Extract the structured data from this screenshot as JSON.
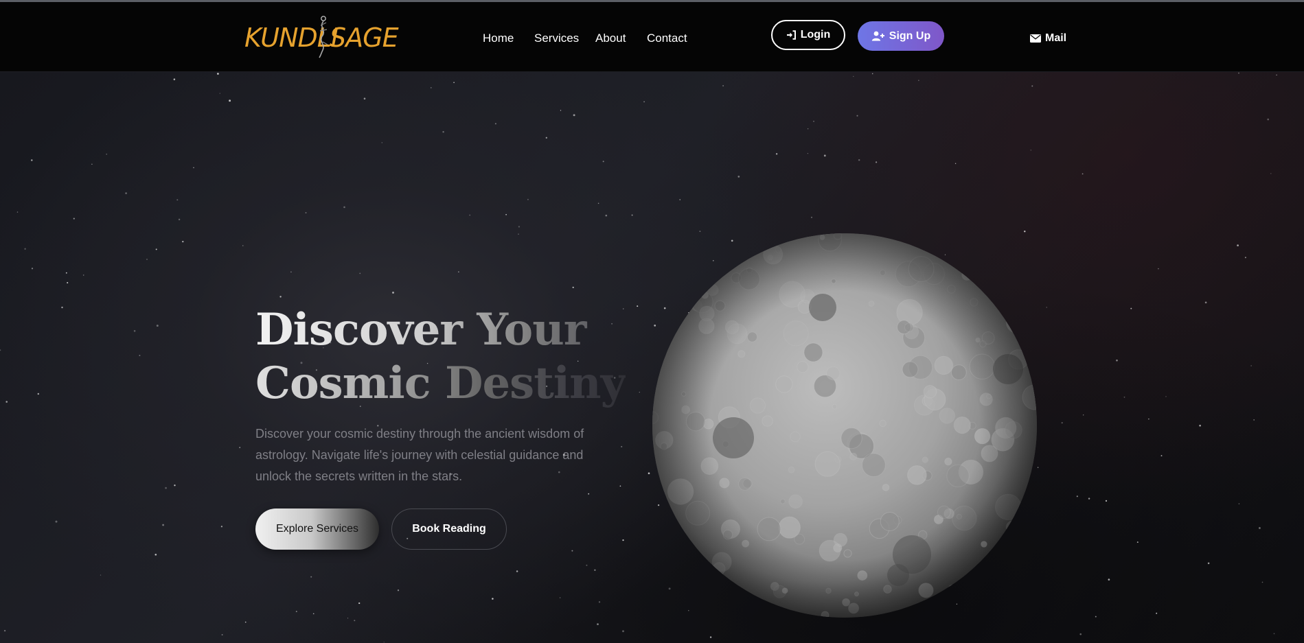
{
  "brand": {
    "logo_left": "KUNDLI",
    "logo_right": "SAGE",
    "color": "#e6a22e"
  },
  "nav": {
    "links": [
      {
        "label": "Home"
      },
      {
        "label": "Services"
      },
      {
        "label": "About"
      },
      {
        "label": "Contact"
      }
    ],
    "login_label": "Login",
    "signup_label": "Sign Up",
    "mail_label": "Mail",
    "icons": {
      "login": "sign-in-icon",
      "signup": "user-plus-icon",
      "mail": "envelope-icon"
    },
    "signup_gradient": [
      "#6e76e6",
      "#7f57c8"
    ]
  },
  "hero": {
    "headline_line1": "Discover Your",
    "headline_line2": "Cosmic Destiny",
    "description": "Discover your cosmic destiny through the ancient wisdom of astrology. Navigate life's journey with celestial guidance and unlock the secrets written in the stars.",
    "primary_cta": "Explore Services",
    "secondary_cta": "Book Reading",
    "image": "moon"
  }
}
